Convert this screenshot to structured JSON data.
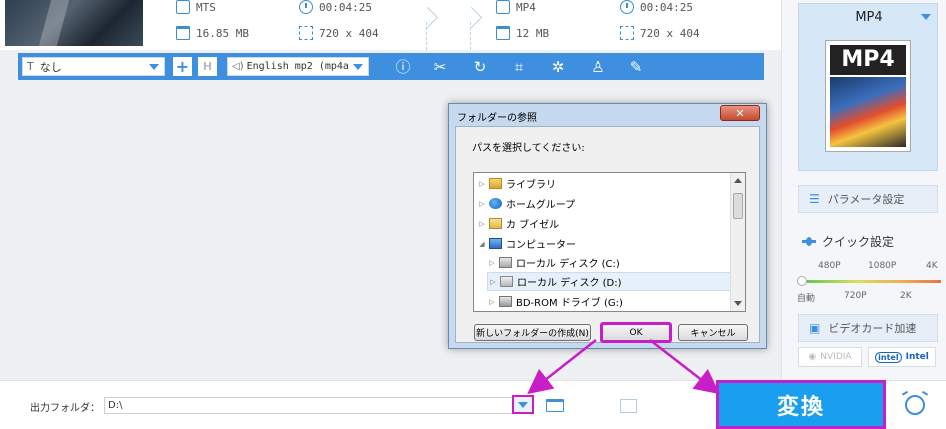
{
  "file": {
    "source": {
      "format": "MTS",
      "duration": "00:04:25",
      "size": "16.85 MB",
      "resolution": "720 x 404"
    },
    "output": {
      "format": "MP4",
      "duration": "00:04:25",
      "size": "12 MB",
      "resolution": "720 x 404"
    }
  },
  "toolbar": {
    "subtitle_value": "なし",
    "audio_value": "English mp2 (mp4a",
    "icons": [
      "info-icon",
      "cut-icon",
      "rotate-icon",
      "crop-icon",
      "effect-icon",
      "watermark-icon",
      "edit-icon"
    ]
  },
  "right_panel": {
    "format_label": "MP4",
    "format_icon_text": "MP4",
    "param_label": "パラメータ設定",
    "quick_title": "クイック設定",
    "quick_top_labels": [
      "480P",
      "1080P",
      "4K"
    ],
    "quick_bottom_labels": [
      "自動",
      "720P",
      "2K"
    ],
    "quick_value": "自動",
    "gpu_label": "ビデオカード加速",
    "nvidia": "NVIDIA",
    "intel": "Intel"
  },
  "dialog": {
    "title": "フォルダーの参照",
    "close": "✕",
    "prompt": "パスを選択してください:",
    "tree": [
      {
        "label": "ライブラリ",
        "indent": 0,
        "expander": "▷"
      },
      {
        "label": "ホームグループ",
        "indent": 0,
        "expander": "▷"
      },
      {
        "label": "カ ブイゼル",
        "indent": 0,
        "expander": "▷"
      },
      {
        "label": "コンピューター",
        "indent": 0,
        "expander": "◢"
      },
      {
        "label": "ローカル ディスク (C:)",
        "indent": 1,
        "expander": "▷"
      },
      {
        "label": "ローカル ディスク (D:)",
        "indent": 1,
        "expander": "▷"
      },
      {
        "label": "BD-ROM ドライブ (G:)",
        "indent": 1,
        "expander": "▷"
      }
    ],
    "new_folder": "新しいフォルダーの作成(N)",
    "ok": "OK",
    "cancel": "キャンセル"
  },
  "bottom": {
    "output_label": "出力フォルダ：",
    "output_value": "D:\\",
    "convert": "変換"
  },
  "colors": {
    "accent": "#3e8fe0",
    "highlight": "#c81ec8",
    "convert": "#1a9ef0"
  }
}
